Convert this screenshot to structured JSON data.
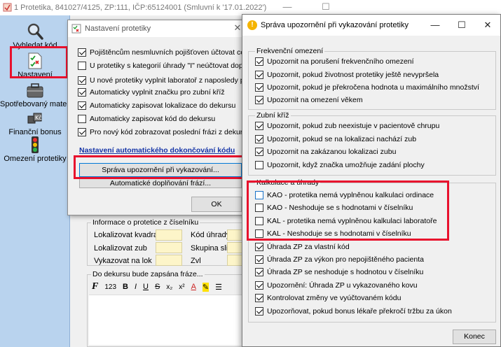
{
  "main_window": {
    "title": "1 Protetika, 841027/4125, ZP:111, IČP:65124001 (Smluvní k '17.01.2022')",
    "nav": [
      {
        "label": "Vyhledat kód",
        "icon": "magnifier-icon"
      },
      {
        "label": "Nastavení",
        "icon": "checklist-icon"
      },
      {
        "label": "Spotřebovaný materi",
        "icon": "toolbox-icon"
      },
      {
        "label": "Finanční bonus",
        "icon": "money-cubes-icon"
      },
      {
        "label": "Omezení protetiky",
        "icon": "traffic-light-icon"
      }
    ],
    "info_group": {
      "title": "Informace o protetice z číselníku",
      "labels": [
        "Lokalizovat kvadrant",
        "Lokalizovat zub",
        "Vykazovat na lok",
        "Kód úhrady",
        "Skupina slitin",
        "Zvl"
      ]
    },
    "editor_group": {
      "title": "Do dekursu bude zapsána fráze...",
      "toolbar": [
        "F",
        "123",
        "B",
        "I",
        "U",
        "S",
        "x₂",
        "x²",
        "A",
        "✎",
        "☰"
      ]
    }
  },
  "settings_dialog": {
    "title": "Nastavení protetiky",
    "checkboxes": [
      {
        "label": "Pojištěncům nesmluvních pojišťoven účtovat celou úhradu",
        "checked": true
      },
      {
        "label": "U protetiky s kategorií úhrady \"I\" neúčtovat doplatek paci",
        "checked": false
      },
      {
        "label": "U nové protetiky vyplnit laboratoř z naposledy přidané prot",
        "checked": true
      },
      {
        "label": "Automaticky vyplnit značku pro zubní kříž",
        "checked": true
      },
      {
        "label": "Automaticky zapisovat lokalizace do dekursu",
        "checked": true
      },
      {
        "label": "Automaticky zapisovat kód do dekursu",
        "checked": false
      },
      {
        "label": "Pro nový kód zobrazovat poslední frázi z dekursu",
        "checked": true
      }
    ],
    "link": "Nastavení automatického dokončování kódu",
    "btn_notifications": "Správa upozornění při vykazování...",
    "btn_autocomplete": "Automatické doplňování frází...",
    "btn_ok": "OK"
  },
  "notifications_dialog": {
    "title": "Správa upozornění při vykazování protetiky",
    "sections": [
      {
        "title": "Frekvenční omezení",
        "items": [
          {
            "label": "Upozornit na porušení frekvenčního omezení",
            "checked": true
          },
          {
            "label": "Upozornit, pokud životnost protetiky ještě nevypršela",
            "checked": true
          },
          {
            "label": "Upozornit, pokud je překročena hodnota u maximálního množství",
            "checked": true
          },
          {
            "label": "Upozornit na omezení věkem",
            "checked": true
          }
        ]
      },
      {
        "title": "Zubní kříž",
        "items": [
          {
            "label": "Upozornit, pokud zub neexistuje v pacientově chrupu",
            "checked": true
          },
          {
            "label": "Upozornit, pokud se na lokalizaci nachází zub",
            "checked": true
          },
          {
            "label": "Upozornit na zakázanou lokalizaci zubu",
            "checked": true
          },
          {
            "label": "Upozornit, když značka umožňuje zadání plochy",
            "checked": false
          }
        ]
      },
      {
        "title": "Kalkulace a úhrady",
        "items": [
          {
            "label": "KAO - protetika nemá vyplněnou kalkulaci ordinace",
            "checked": false
          },
          {
            "label": "KAO - Neshoduje se s hodnotami v číselníku",
            "checked": false
          },
          {
            "label": "KAL - protetika nemá vyplněnou kalkulaci laboratoře",
            "checked": false
          },
          {
            "label": "KAL - Neshoduje se s hodnotami v číselníku",
            "checked": false
          },
          {
            "label": "Úhrada ZP za vlastní kód",
            "checked": true
          },
          {
            "label": "Úhrada ZP za výkon pro nepojištěného pacienta",
            "checked": true
          },
          {
            "label": "Úhrada ZP se neshoduje s hodnotou v číselníku",
            "checked": true
          },
          {
            "label": "Upozornění: Úhrada ZP u vykazovaného kovu",
            "checked": true
          },
          {
            "label": "Kontrolovat změny ve vyúčtovaném kódu",
            "checked": true
          },
          {
            "label": "Upozorňovat, pokud bonus lékaře překročí tržbu za úkon",
            "checked": true
          }
        ]
      }
    ],
    "btn_close": "Konec"
  }
}
